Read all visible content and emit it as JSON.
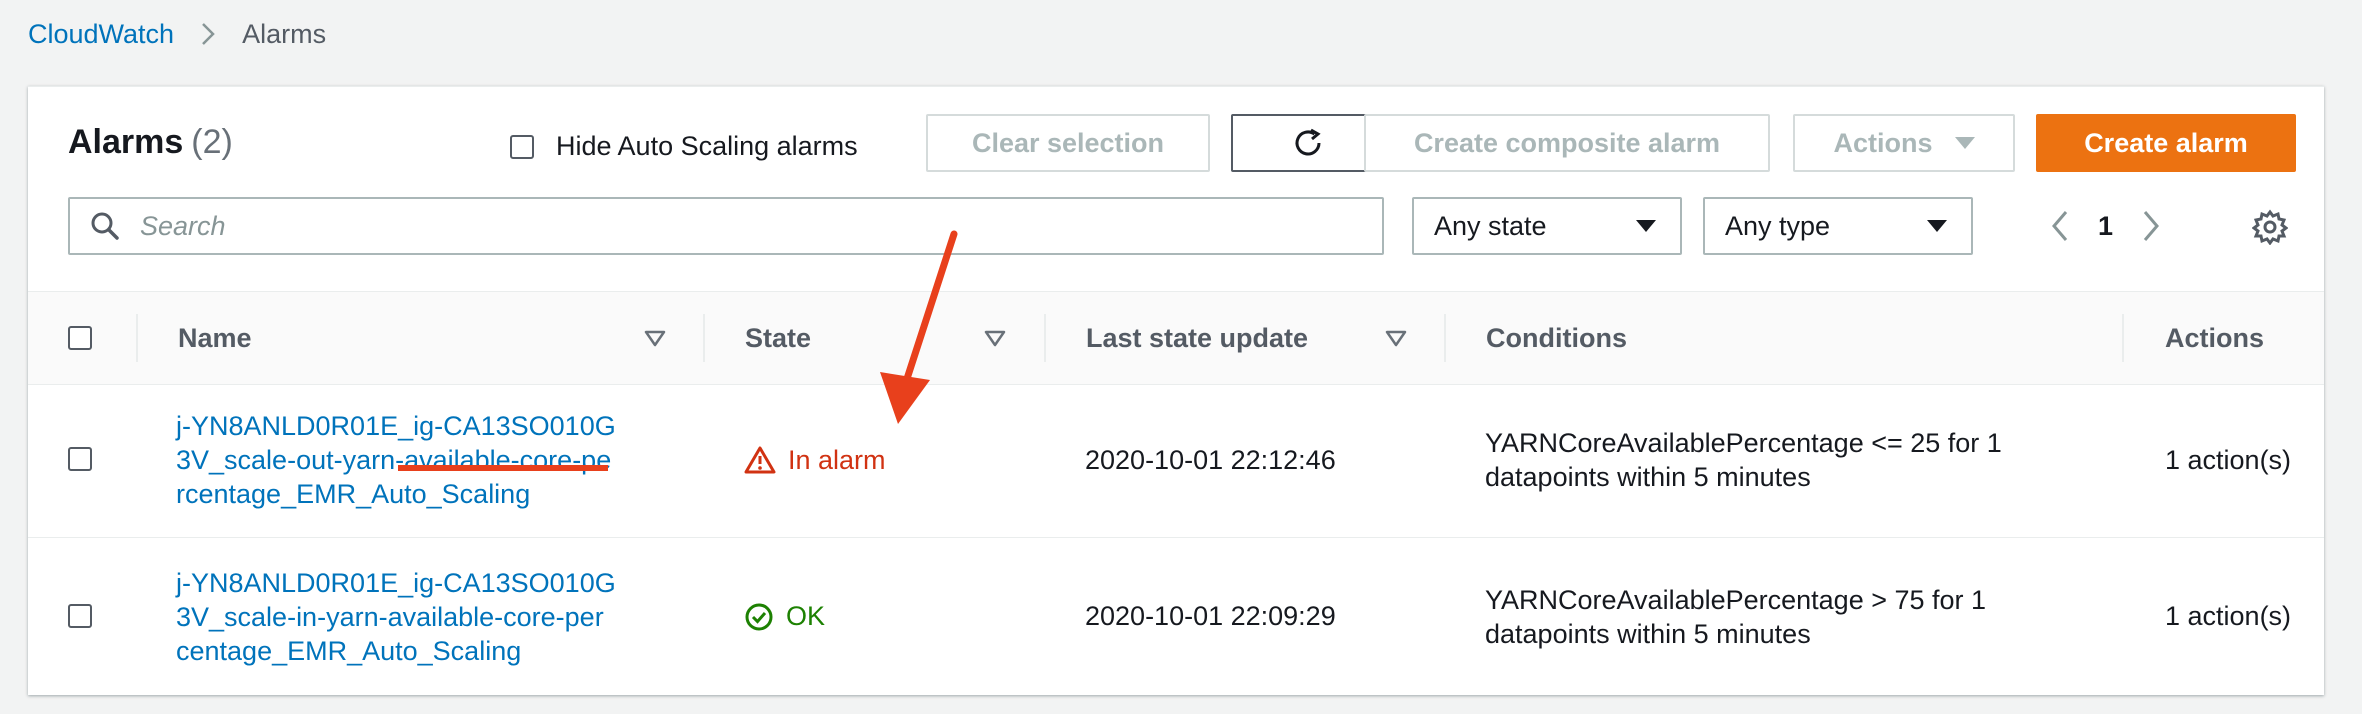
{
  "breadcrumb": {
    "root": "CloudWatch",
    "current": "Alarms"
  },
  "header": {
    "title": "Alarms",
    "count": "(2)",
    "hide_autoscaling_label": "Hide Auto Scaling alarms",
    "clear_selection": "Clear selection",
    "create_composite": "Create composite alarm",
    "actions": "Actions",
    "create_alarm": "Create alarm"
  },
  "filters": {
    "search_placeholder": "Search",
    "state_select": "Any state",
    "type_select": "Any type",
    "page": "1"
  },
  "table": {
    "columns": [
      "Name",
      "State",
      "Last state update",
      "Conditions",
      "Actions"
    ],
    "rows": [
      {
        "name": "j-YN8ANLD0R01E_ig-CA13SO010G3V_scale-out-yarn-available-core-percentage_EMR_Auto_Scaling",
        "state": "In alarm",
        "last_update": "2020-10-01 22:12:46",
        "conditions": "YARNCoreAvailablePercentage <= 25 for 1 datapoints within 5 minutes",
        "actions": "1 action(s)"
      },
      {
        "name": "j-YN8ANLD0R01E_ig-CA13SO010G3V_scale-in-yarn-available-core-percentage_EMR_Auto_Scaling",
        "state": "OK",
        "last_update": "2020-10-01 22:09:29",
        "conditions": "YARNCoreAvailablePercentage > 75 for 1 datapoints within 5 minutes",
        "actions": "1 action(s)"
      }
    ]
  },
  "colors": {
    "link": "#0073bb",
    "primary_button": "#ec7211",
    "alarm": "#d13212",
    "ok": "#1d8102",
    "annotation": "#e8401c"
  },
  "icons": [
    "chevron-right-icon",
    "refresh-icon",
    "search-icon",
    "chevron-left-icon",
    "gear-icon",
    "sort-icon",
    "warning-icon",
    "check-circle-icon"
  ]
}
